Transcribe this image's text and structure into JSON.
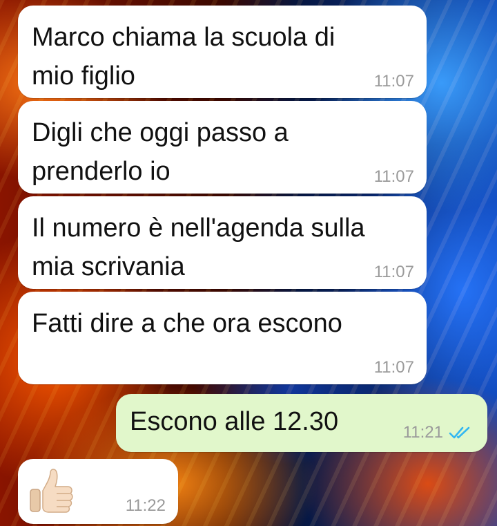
{
  "colors": {
    "incoming_bubble": "#ffffff",
    "outgoing_bubble": "#e1f7cb",
    "time_text": "#9a9a9a",
    "read_ticks": "#34b7f1"
  },
  "messages": [
    {
      "direction": "incoming",
      "text": "Marco chiama la scuola di\nmio figlio",
      "time": "11:07"
    },
    {
      "direction": "incoming",
      "text": "Digli che oggi passo a\nprenderlo io",
      "time": "11:07"
    },
    {
      "direction": "incoming",
      "text": "Il numero è nell'agenda sulla\nmia scrivania",
      "time": "11:07"
    },
    {
      "direction": "incoming",
      "text": "Fatti dire a che ora escono",
      "time": "11:07"
    },
    {
      "direction": "outgoing",
      "text": "Escono alle 12.30",
      "time": "11:21",
      "status": "read",
      "status_icon": "double-check-icon"
    },
    {
      "direction": "incoming",
      "emoji": "thumbs-up-icon",
      "time": "11:22"
    }
  ]
}
